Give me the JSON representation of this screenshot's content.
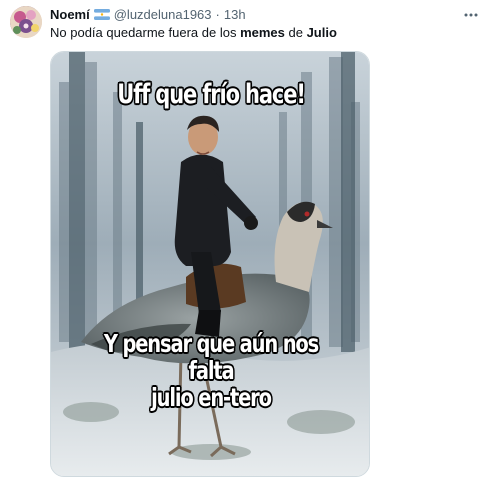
{
  "tweet": {
    "author": {
      "name": "Noemí",
      "handle": "@luzdeluna1963",
      "separator": "·",
      "time": "13h",
      "avatar_icon": "avatar-flowers-icon",
      "flag_icon": "argentina-flag-icon"
    },
    "text": {
      "part1": "No podía quedarme fuera de los ",
      "bold1": "memes",
      "part2": " de ",
      "bold2": "Julio"
    },
    "more_icon": "more-dots-icon",
    "meme": {
      "top_caption": "Uff que frío hace!",
      "bottom_line1": "Y pensar que aún nos falta",
      "bottom_line2": "julio en-tero"
    }
  },
  "colors": {
    "text": "#0f1419",
    "secondary": "#536471",
    "border": "#cfd9de",
    "flag_blue": "#74acdf",
    "flag_sun": "#f6b40e"
  }
}
